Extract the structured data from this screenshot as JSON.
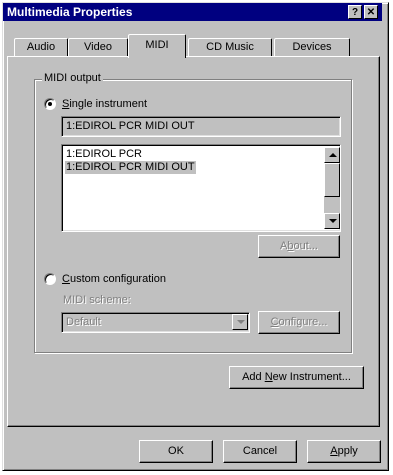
{
  "window": {
    "title": "Multimedia Properties",
    "help_glyph": "?",
    "close_glyph": "✕"
  },
  "tabs": [
    {
      "label": "Audio",
      "active": false
    },
    {
      "label": "Video",
      "active": false
    },
    {
      "label": "MIDI",
      "active": true
    },
    {
      "label": "CD Music",
      "active": false
    },
    {
      "label": "Devices",
      "active": false
    }
  ],
  "midi_output": {
    "group_label": "MIDI output",
    "single": {
      "label": "Single instrument",
      "mnemonic": "S",
      "rest": "ingle instrument",
      "selected": true,
      "current_value": "1:EDIROL PCR MIDI OUT",
      "list": [
        "1:EDIROL PCR",
        "1:EDIROL PCR MIDI OUT"
      ],
      "selected_index": 1,
      "about_button": {
        "pre": "A",
        "mnemonic": "b",
        "post": "out...",
        "label": "About..."
      }
    },
    "custom": {
      "label": "Custom configuration",
      "mnemonic": "C",
      "rest": "ustom configuration",
      "selected": false,
      "scheme_label": "MIDI scheme:",
      "scheme_value": "Default",
      "configure_button": {
        "mnemonic": "C",
        "rest": "onfigure...",
        "label": "Configure..."
      }
    }
  },
  "add_new_instrument": {
    "pre": "Add ",
    "mnemonic": "N",
    "post": "ew Instrument...",
    "label": "Add New Instrument..."
  },
  "footer": {
    "ok": "OK",
    "cancel": "Cancel",
    "apply": {
      "mnemonic": "A",
      "rest": "pply",
      "label": "Apply"
    }
  }
}
